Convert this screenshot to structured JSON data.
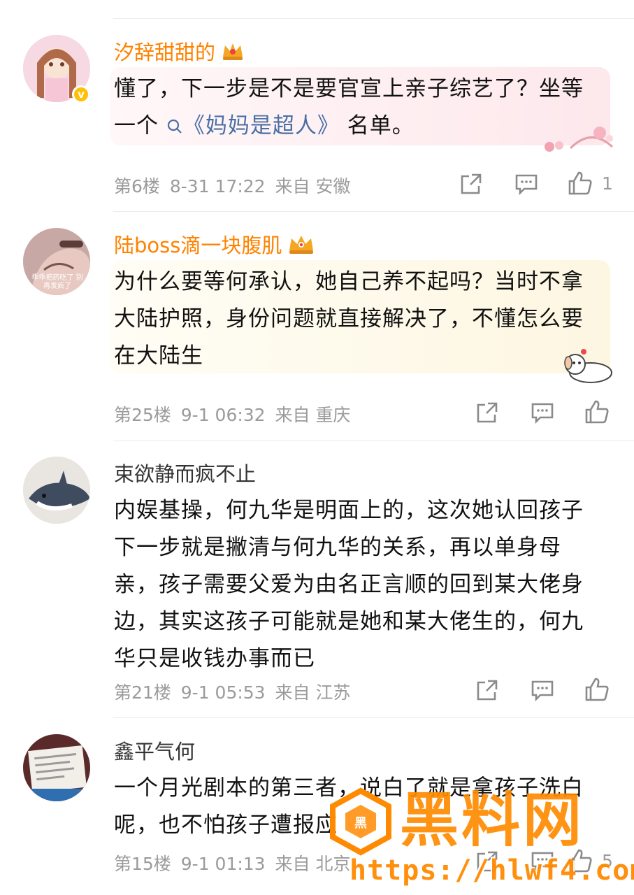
{
  "comments": [
    {
      "username": "汐辞甜甜的",
      "text_before": "懂了，下一步是不是要官宣上亲子综艺了？坐等一个",
      "topic_link": "《妈妈是超人》",
      "text_after": "名单。",
      "floor": "第6楼",
      "time": "8-31 17:22",
      "from": "来自 安徽",
      "like_count": "1"
    },
    {
      "username": "陆boss滴一块腹肌",
      "text": "为什么要等何承认，她自己养不起吗？当时不拿大陆护照，身份问题就直接解决了，不懂怎么要在大陆生",
      "floor": "第25楼",
      "time": "9-1 06:32",
      "from": "来自 重庆",
      "avatar_text": "乖乖把药吃了 别再发疯了"
    },
    {
      "username": "束欲静而疯不止",
      "text": "内娱基操，何九华是明面上的，这次她认回孩子下一步就是撇清与何九华的关系，再以单身母亲，孩子需要父爱为由名正言顺的回到某大佬身边，其实这孩子可能就是她和某大佬生的，何九华只是收钱办事而已",
      "floor": "第21楼",
      "time": "9-1 05:53",
      "from": "来自 江苏"
    },
    {
      "username": "鑫平气何",
      "text": "一个月光剧本的第三者，说白了就是拿孩子洗白呢，也不怕孩子遭报应",
      "floor": "第15楼",
      "time": "9-1 01:13",
      "from": "来自 北京",
      "like_count": "5"
    }
  ],
  "watermark": {
    "brand": "黑料网",
    "url": "https://hlwf4.com"
  },
  "colors": {
    "vip_name": "#ff8200",
    "meta_gray": "#9b9b9b",
    "topic_link": "#4a6fa5",
    "watermark_orange": "#ff8a00"
  }
}
